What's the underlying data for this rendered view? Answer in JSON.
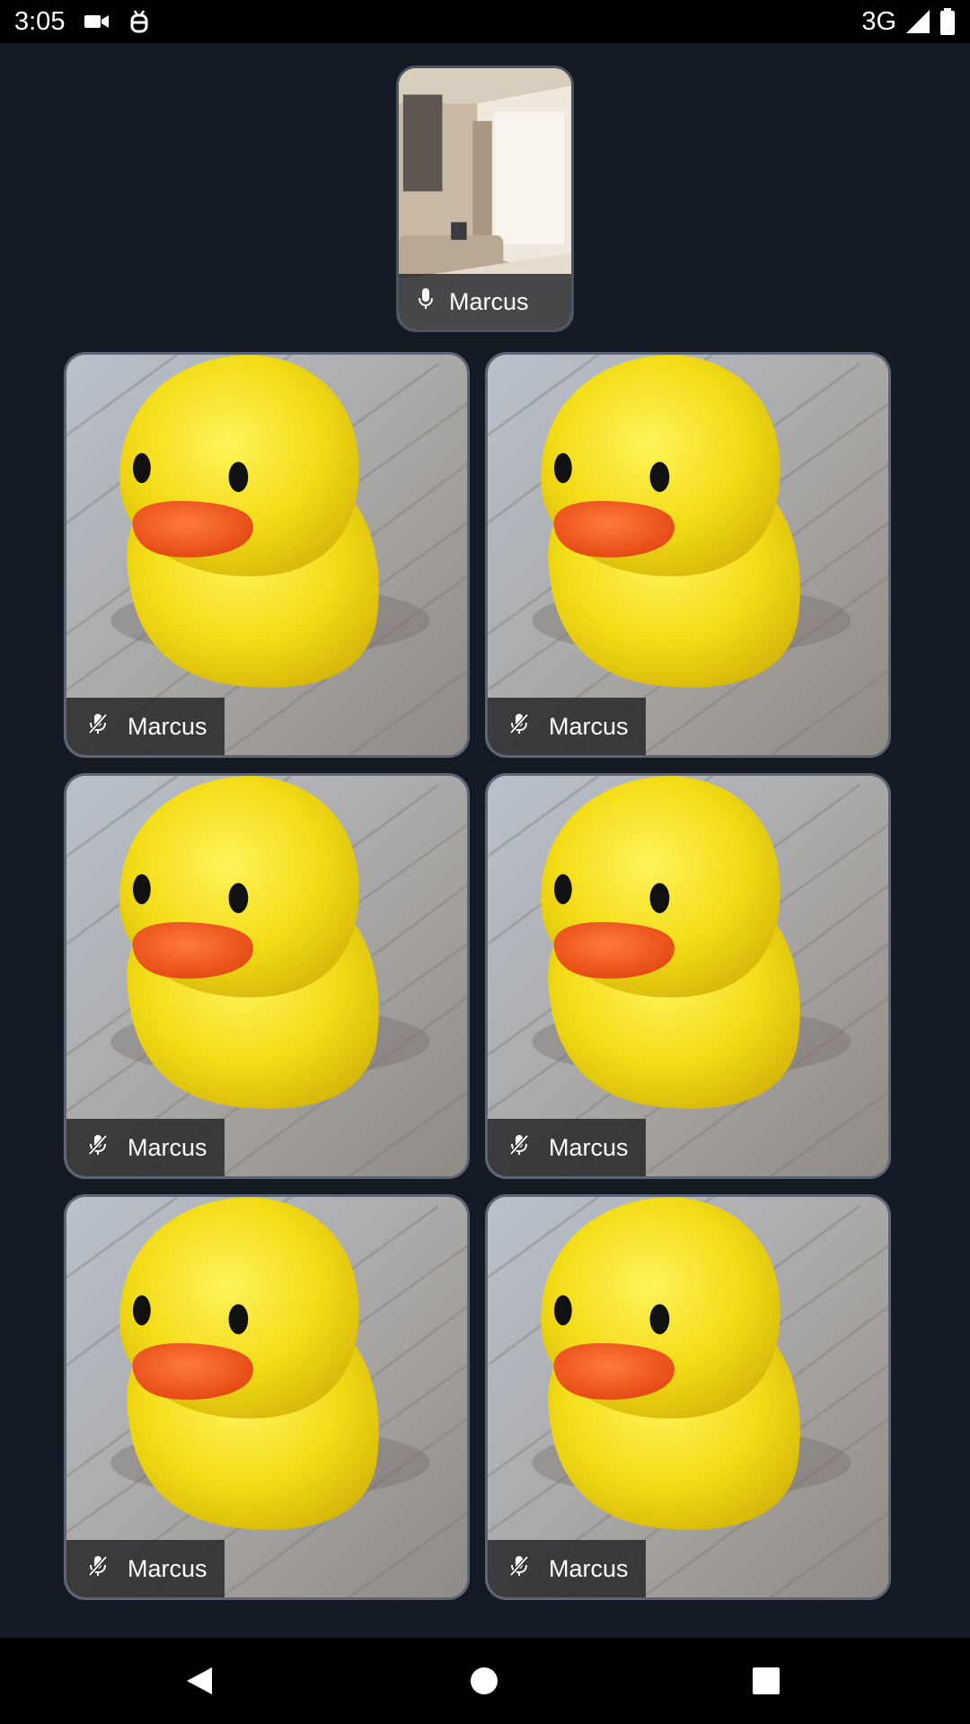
{
  "status_bar": {
    "time": "3:05",
    "network": "3G",
    "icons": [
      "video-camera-icon",
      "debug-icon",
      "cellular-signal-icon",
      "battery-icon"
    ]
  },
  "self_view": {
    "name": "Marcus",
    "mic_icon": "mic-icon",
    "mic_muted": false
  },
  "participants": [
    {
      "name": "Marcus",
      "mic_icon": "mic-off-icon",
      "mic_muted": true
    },
    {
      "name": "Marcus",
      "mic_icon": "mic-off-icon",
      "mic_muted": true
    },
    {
      "name": "Marcus",
      "mic_icon": "mic-off-icon",
      "mic_muted": true
    },
    {
      "name": "Marcus",
      "mic_icon": "mic-off-icon",
      "mic_muted": true
    },
    {
      "name": "Marcus",
      "mic_icon": "mic-off-icon",
      "mic_muted": true
    },
    {
      "name": "Marcus",
      "mic_icon": "mic-off-icon",
      "mic_muted": true
    }
  ],
  "nav_bar": {
    "icons": [
      "back-icon",
      "home-icon",
      "recents-icon"
    ]
  },
  "colors": {
    "background": "#131a24",
    "tile_border": "#5a6676",
    "label_background": "#222224",
    "duck_yellow": "#f5e21e",
    "beak_orange": "#f2521c"
  }
}
